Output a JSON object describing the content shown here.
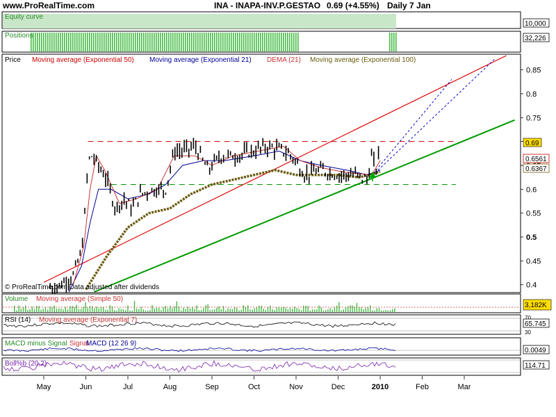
{
  "header": {
    "site": "www.ProRealTime.com",
    "instrument": "INA - INAPA-INV.P.GESTAO",
    "quote": "0.69 (+4.55%)",
    "period": "Daily  7 Jan"
  },
  "colors": {
    "ema50": "#cc0000",
    "ema21": "#000099",
    "dema21": "#cc3333",
    "ema100": "#6b5a10",
    "up_trend": "#009900",
    "resistance": "#cc0000",
    "support_dashed": "#009900",
    "panel_green": "#c8e6c8",
    "volume": "#44bb44",
    "last_price_box": "#ffdd00"
  },
  "panels": {
    "equity": {
      "label": "Equity curve",
      "value": "10,000"
    },
    "positions": {
      "label": "Positions",
      "value": "32,226"
    },
    "price": {
      "label": "Price",
      "legend": [
        {
          "name": "Moving average (Exponential 50)",
          "color": "#cc0000"
        },
        {
          "name": "Moving average (Exponential 21)",
          "color": "#000099"
        },
        {
          "name": "DEMA (21)",
          "color": "#cc3333"
        },
        {
          "name": "Moving average (Exponential 100)",
          "color": "#6b5a10"
        }
      ],
      "watermark": "© ProRealTime.com  Data adjusted after dividends",
      "last_value": "0.69",
      "ema50_value": "0.6561",
      "ema100_value": "0.6367"
    },
    "volume": {
      "label": "Volume",
      "indicator": "Moving average (Simple 50)",
      "value": "3,182K"
    },
    "rsi": {
      "label": "RSI (14)",
      "indicator": "Moving average (Exponential 7)",
      "value": "65.745",
      "levels": [
        "70",
        "30"
      ]
    },
    "macd": {
      "label": "MACD minus Signal",
      "indicator": "Signal",
      "indicator2": "MACD (12 26 9)",
      "value": "0.0049"
    },
    "bollinger": {
      "label": "Boll%b (20,2)",
      "value": "114.71"
    }
  },
  "chart_data": {
    "type": "line",
    "title": "INA - INAPA-INV.P.GESTAO",
    "y_ticks": [
      0.4,
      0.45,
      0.5,
      0.55,
      0.6,
      0.65,
      0.7,
      0.75,
      0.8,
      0.85
    ],
    "y_tick_labels": [
      "0.4",
      "0.45",
      "0.5",
      "0.55",
      "0.6",
      "0.65",
      "0.7",
      "0.75",
      "0.8",
      "0.85"
    ],
    "ylim": [
      0.385,
      0.88
    ],
    "x_labels": [
      "May",
      "Jun",
      "Jul",
      "Aug",
      "Sep",
      "Oct",
      "Nov",
      "Dec",
      "2010",
      "Feb",
      "Mar"
    ],
    "price_close": [
      {
        "x": 0,
        "y": 0.39
      },
      {
        "x": 0.4,
        "y": 0.4
      },
      {
        "x": 0.7,
        "y": 0.42
      },
      {
        "x": 0.9,
        "y": 0.47
      },
      {
        "x": 1.0,
        "y": 0.57
      },
      {
        "x": 1.05,
        "y": 0.66
      },
      {
        "x": 1.15,
        "y": 0.67
      },
      {
        "x": 1.3,
        "y": 0.65
      },
      {
        "x": 1.5,
        "y": 0.62
      },
      {
        "x": 1.7,
        "y": 0.56
      },
      {
        "x": 1.9,
        "y": 0.58
      },
      {
        "x": 2.1,
        "y": 0.56
      },
      {
        "x": 2.3,
        "y": 0.59
      },
      {
        "x": 2.6,
        "y": 0.6
      },
      {
        "x": 2.9,
        "y": 0.6
      },
      {
        "x": 3.1,
        "y": 0.68
      },
      {
        "x": 3.3,
        "y": 0.68
      },
      {
        "x": 3.6,
        "y": 0.69
      },
      {
        "x": 3.9,
        "y": 0.64
      },
      {
        "x": 4.2,
        "y": 0.67
      },
      {
        "x": 4.6,
        "y": 0.67
      },
      {
        "x": 5.0,
        "y": 0.68
      },
      {
        "x": 5.3,
        "y": 0.69
      },
      {
        "x": 5.7,
        "y": 0.68
      },
      {
        "x": 5.9,
        "y": 0.67
      },
      {
        "x": 6.2,
        "y": 0.63
      },
      {
        "x": 6.6,
        "y": 0.64
      },
      {
        "x": 7.0,
        "y": 0.63
      },
      {
        "x": 7.4,
        "y": 0.63
      },
      {
        "x": 7.7,
        "y": 0.62
      },
      {
        "x": 7.8,
        "y": 0.67
      },
      {
        "x": 7.9,
        "y": 0.64
      },
      {
        "x": 8.0,
        "y": 0.69
      }
    ],
    "ema21": [
      {
        "x": 0.6,
        "y": 0.385
      },
      {
        "x": 0.9,
        "y": 0.44
      },
      {
        "x": 1.1,
        "y": 0.53
      },
      {
        "x": 1.3,
        "y": 0.6
      },
      {
        "x": 1.6,
        "y": 0.6
      },
      {
        "x": 2.0,
        "y": 0.58
      },
      {
        "x": 2.5,
        "y": 0.59
      },
      {
        "x": 2.9,
        "y": 0.61
      },
      {
        "x": 3.3,
        "y": 0.65
      },
      {
        "x": 3.8,
        "y": 0.66
      },
      {
        "x": 4.3,
        "y": 0.66
      },
      {
        "x": 5.0,
        "y": 0.67
      },
      {
        "x": 5.6,
        "y": 0.68
      },
      {
        "x": 6.1,
        "y": 0.66
      },
      {
        "x": 6.6,
        "y": 0.65
      },
      {
        "x": 7.2,
        "y": 0.64
      },
      {
        "x": 7.7,
        "y": 0.63
      },
      {
        "x": 8.0,
        "y": 0.64
      }
    ],
    "dema21": [
      {
        "x": 0.7,
        "y": 0.4
      },
      {
        "x": 0.95,
        "y": 0.48
      },
      {
        "x": 1.1,
        "y": 0.6
      },
      {
        "x": 1.25,
        "y": 0.67
      },
      {
        "x": 1.45,
        "y": 0.64
      },
      {
        "x": 1.8,
        "y": 0.57
      },
      {
        "x": 2.2,
        "y": 0.58
      },
      {
        "x": 2.7,
        "y": 0.6
      },
      {
        "x": 3.1,
        "y": 0.67
      },
      {
        "x": 3.6,
        "y": 0.67
      },
      {
        "x": 4.0,
        "y": 0.65
      },
      {
        "x": 4.5,
        "y": 0.67
      },
      {
        "x": 5.1,
        "y": 0.68
      },
      {
        "x": 5.7,
        "y": 0.69
      },
      {
        "x": 6.1,
        "y": 0.66
      },
      {
        "x": 6.6,
        "y": 0.645
      },
      {
        "x": 7.2,
        "y": 0.635
      },
      {
        "x": 7.8,
        "y": 0.63
      },
      {
        "x": 8.0,
        "y": 0.66
      }
    ],
    "ema100": [
      {
        "x": 1.0,
        "y": 0.39
      },
      {
        "x": 1.5,
        "y": 0.46
      },
      {
        "x": 2.0,
        "y": 0.52
      },
      {
        "x": 2.5,
        "y": 0.55
      },
      {
        "x": 3.0,
        "y": 0.56
      },
      {
        "x": 3.5,
        "y": 0.59
      },
      {
        "x": 4.0,
        "y": 0.61
      },
      {
        "x": 4.5,
        "y": 0.62
      },
      {
        "x": 5.0,
        "y": 0.63
      },
      {
        "x": 5.5,
        "y": 0.64
      },
      {
        "x": 6.0,
        "y": 0.63
      },
      {
        "x": 6.5,
        "y": 0.63
      },
      {
        "x": 7.0,
        "y": 0.63
      },
      {
        "x": 7.5,
        "y": 0.625
      },
      {
        "x": 8.0,
        "y": 0.6367
      }
    ],
    "resistance_level": 0.7,
    "support_level": 0.61,
    "uptrend_red": [
      {
        "x": 0,
        "y": 0.405
      },
      {
        "x": 11.0,
        "y": 0.88
      }
    ],
    "uptrend_green": [
      {
        "x": 1.2,
        "y": 0.385
      },
      {
        "x": 11.2,
        "y": 0.745
      }
    ]
  }
}
